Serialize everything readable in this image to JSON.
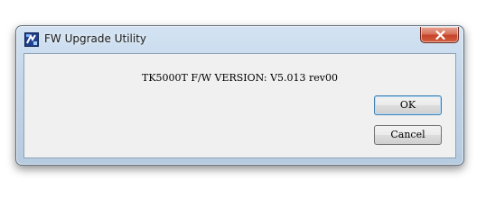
{
  "window": {
    "title": "FW Upgrade Utility",
    "icon": "fw-upgrade-app-icon"
  },
  "dialog": {
    "message": "TK5000T F/W VERSION: V5.013 rev00",
    "ok_label": "OK",
    "cancel_label": "Cancel"
  },
  "colors": {
    "close_button": "#c7432a",
    "frame": "#c3d6ea",
    "client_background": "#f0f0f0"
  }
}
